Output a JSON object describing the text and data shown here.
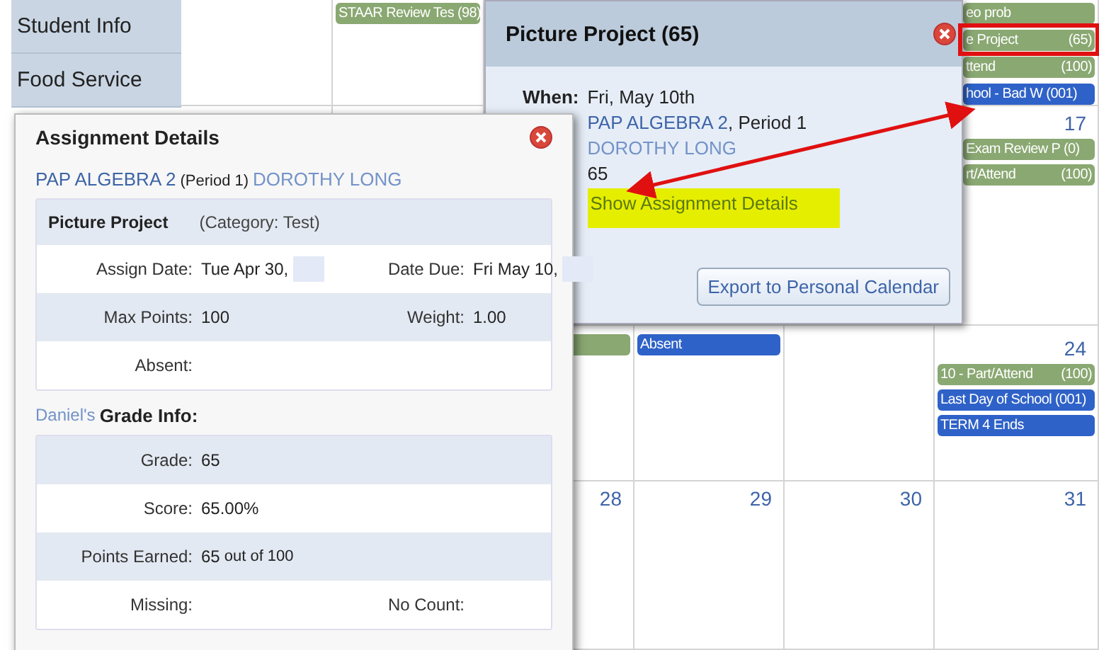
{
  "sidebar": {
    "items": [
      {
        "label": "Student Info"
      },
      {
        "label": "Food Service"
      }
    ]
  },
  "calendar": {
    "weeks": [
      {
        "cells": [
          {},
          {
            "events": [
              {
                "label": "STAAR Review Tes (98)",
                "color": "#8aa872"
              }
            ]
          },
          {},
          {},
          {},
          {
            "events": [
              {
                "label": "eo prob",
                "color": "#8aa872"
              },
              {
                "label": "e Project",
                "score": "(65)",
                "color": "#8aa872"
              },
              {
                "label": "ttend",
                "score": "(100)",
                "color": "#8aa872"
              },
              {
                "label": "hool - Bad W (001)",
                "color": "#2f62c8"
              }
            ]
          }
        ]
      },
      {
        "cells": [
          {},
          {},
          {},
          {},
          {},
          {
            "day": "17",
            "events": [
              {
                "label": "Exam Review P (0)",
                "color": "#8aa872"
              },
              {
                "label": "rt/Attend",
                "score": "(100)",
                "color": "#8aa872"
              }
            ]
          }
        ]
      },
      {
        "cells": [
          {},
          {},
          {
            "events": [
              {
                "color": "#8aa872"
              }
            ]
          },
          {
            "events": [
              {
                "label": "Absent",
                "color": "#2f62c8"
              }
            ]
          },
          {},
          {
            "day": "24",
            "events": [
              {
                "label": "10 - Part/Attend",
                "score": "(100)",
                "color": "#8aa872"
              },
              {
                "label": "Last Day of School (001)",
                "color": "#2f62c8"
              },
              {
                "label": "TERM 4 Ends",
                "color": "#2f62c8"
              }
            ]
          }
        ]
      },
      {
        "cells": [
          {},
          {},
          {
            "day": "28"
          },
          {
            "day": "29"
          },
          {
            "day": "30"
          },
          {
            "day": "31"
          }
        ]
      }
    ]
  },
  "event_popup": {
    "title": "Picture Project (65)",
    "when_label": "When:",
    "date": "Fri, May 10th",
    "course": "PAP ALGEBRA 2",
    "period": ", Period 1",
    "teacher": "DOROTHY LONG",
    "grade": "65",
    "details_link": "Show Assignment Details",
    "export_button": "Export to Personal Calendar"
  },
  "assignment_details": {
    "title": "Assignment Details",
    "course": "PAP ALGEBRA 2",
    "period": "(Period 1)",
    "teacher": "DOROTHY LONG",
    "assignment": {
      "name": "Picture Project",
      "category": "(Category: Test)",
      "rows": [
        [
          {
            "label": "Assign Date:",
            "value": "Tue Apr 30,",
            "redacted": true
          },
          {
            "label": "Date Due:",
            "value": "Fri May 10,",
            "redacted": true
          }
        ],
        [
          {
            "label": "Max Points:",
            "value": "100"
          },
          {
            "label": "Weight:",
            "value": "1.00"
          }
        ],
        [
          {
            "label": "Absent:"
          }
        ]
      ]
    },
    "grade_info": {
      "student": "Daniel's",
      "heading": "Grade Info:",
      "rows": [
        [
          {
            "label": "Grade:",
            "value": "65"
          }
        ],
        [
          {
            "label": "Score:",
            "value": "65.00%"
          }
        ],
        [
          {
            "label": "Points Earned:",
            "value": "65",
            "suffix": "out of 100"
          }
        ],
        [
          {
            "label": "Missing:"
          },
          {
            "label": "No Count:"
          }
        ]
      ]
    }
  }
}
